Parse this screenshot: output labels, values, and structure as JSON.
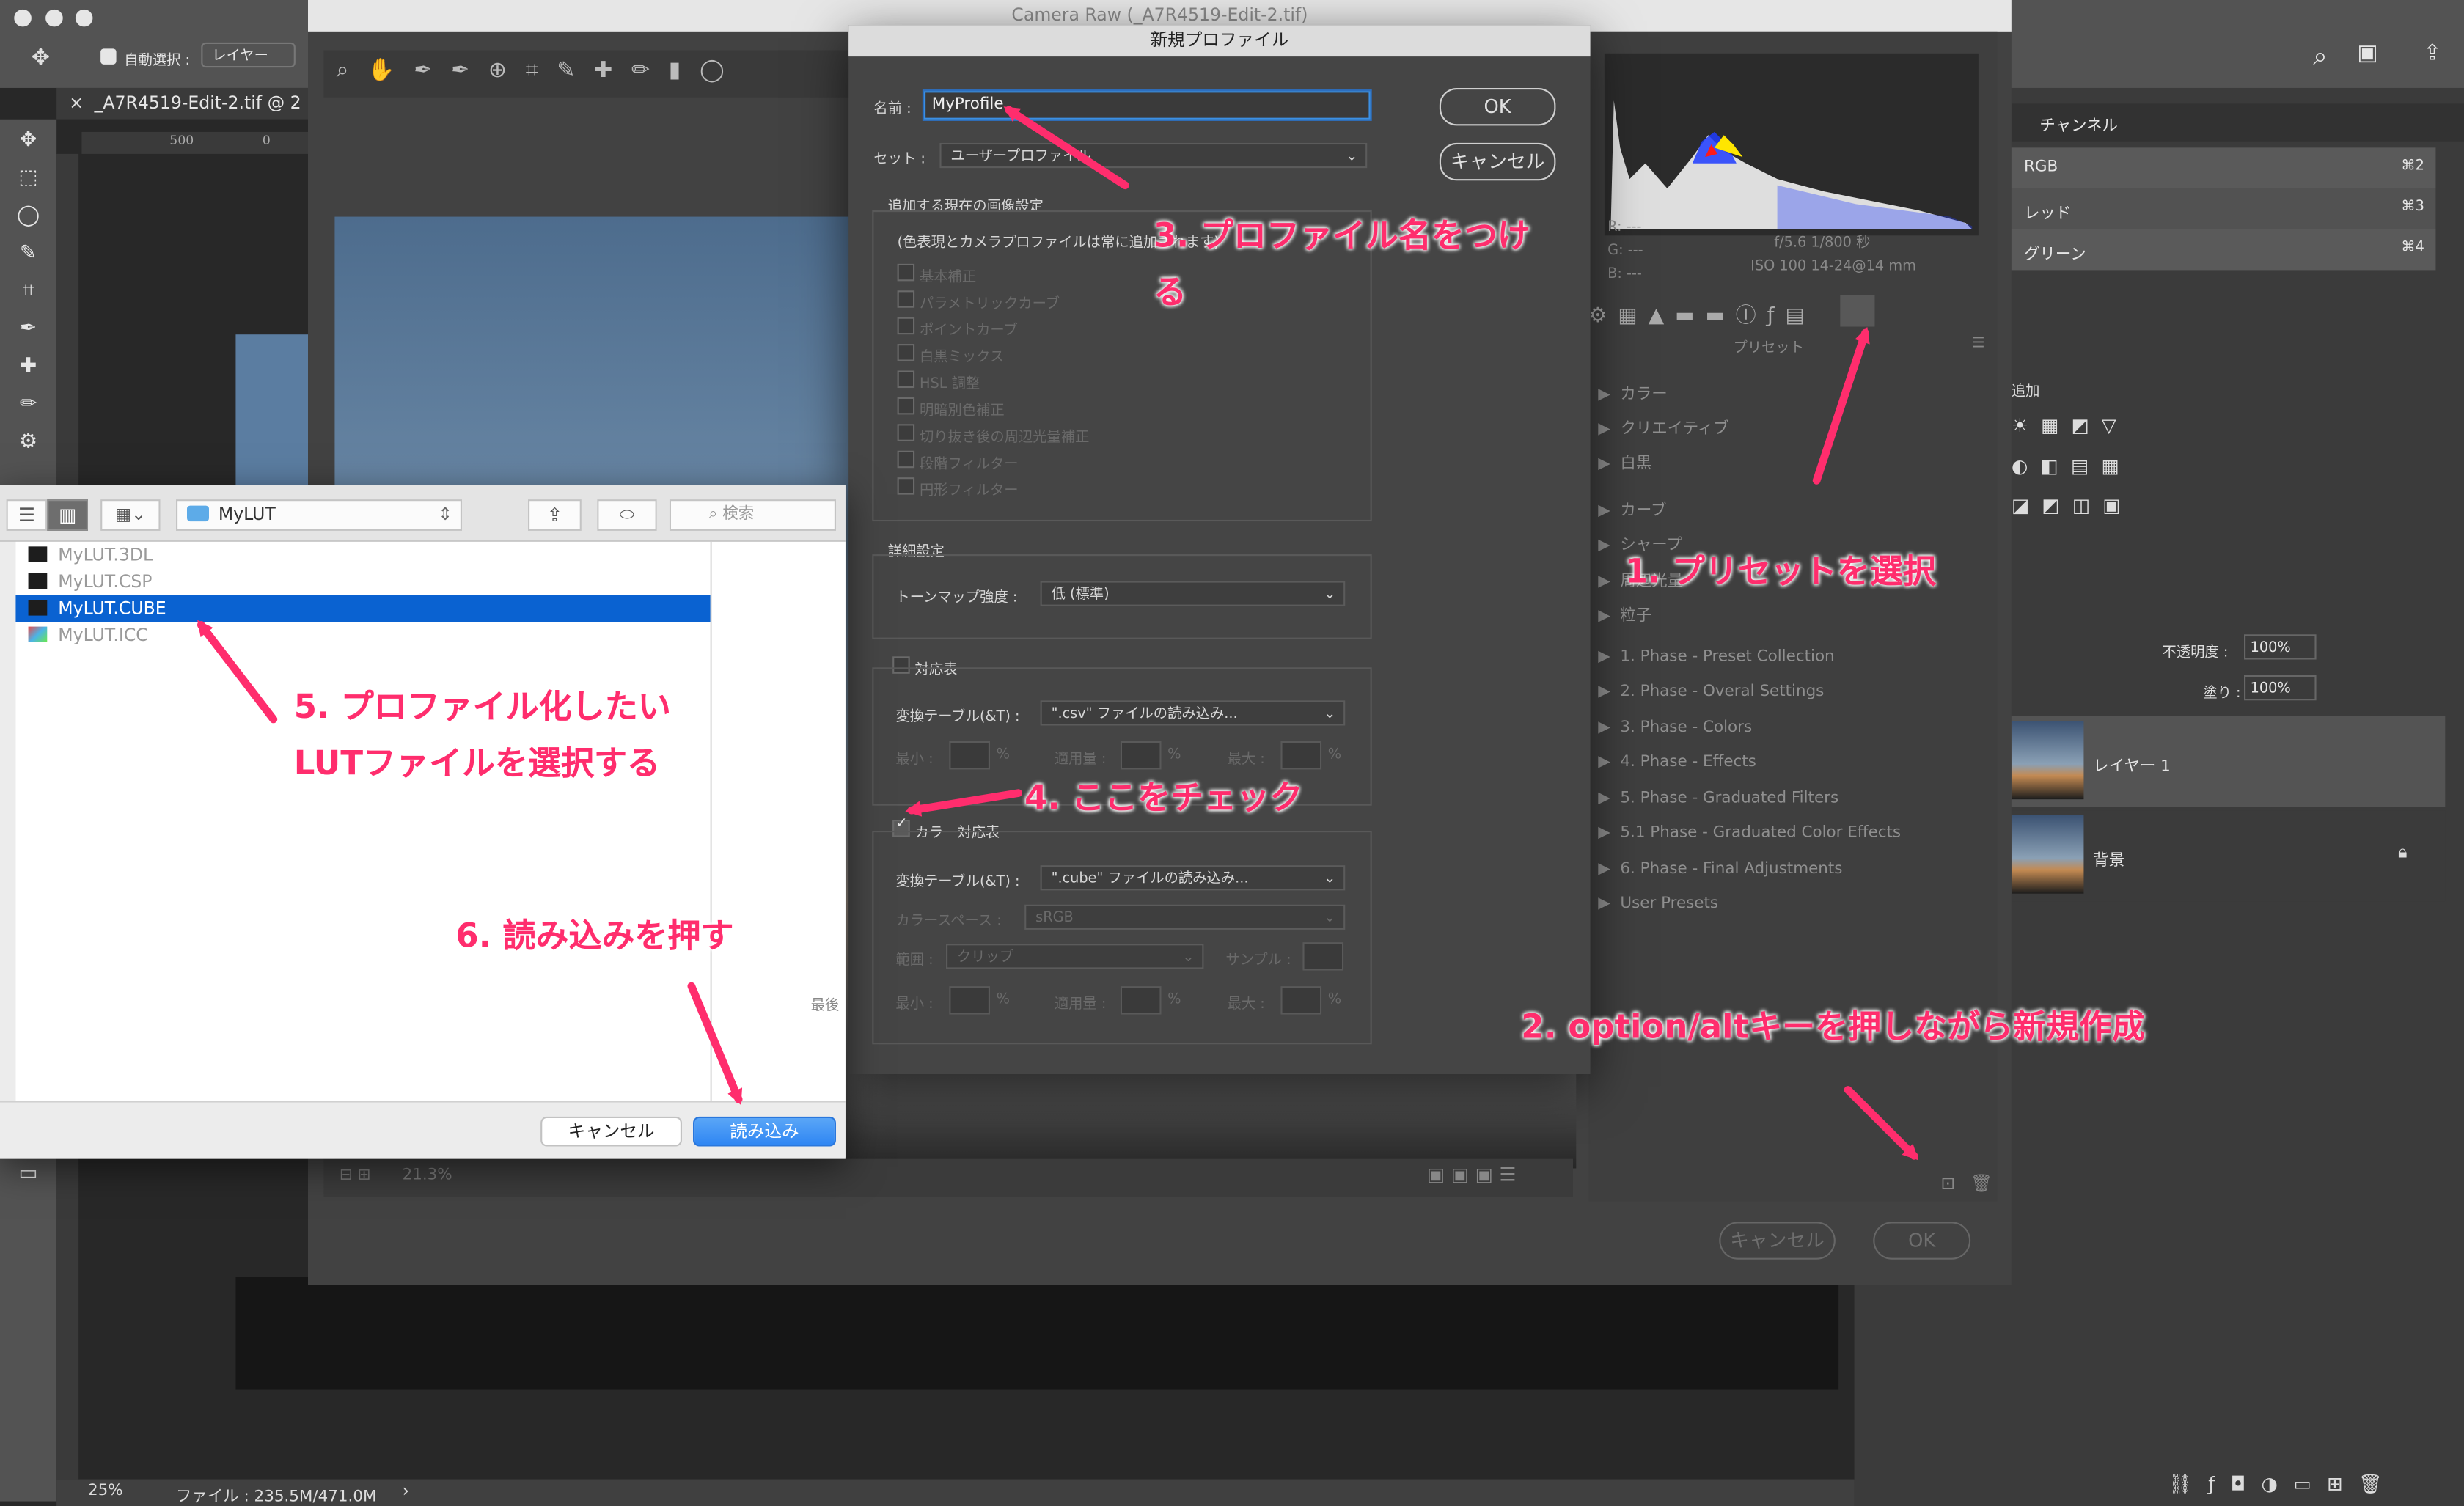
{
  "photoshop": {
    "options": {
      "auto_select": "自動選択 :",
      "layer_select": "レイヤー"
    },
    "doc_tab": "_A7R4519-Edit-2.tif @ 2",
    "ruler_marks": [
      "500",
      "0"
    ],
    "status": {
      "zoom": "25%",
      "file": "ファイル : 235.5M/471.0M"
    },
    "channels": {
      "tab": "チャンネル",
      "rows": [
        {
          "name": "RGB",
          "key": "⌘2"
        },
        {
          "name": "レッド",
          "key": "⌘3"
        },
        {
          "name": "グリーン",
          "key": "⌘4"
        }
      ]
    },
    "adjust_label": "追加",
    "layers": {
      "opacity_label": "不透明度 :",
      "opacity": "100%",
      "fill_label": "塗り :",
      "fill": "100%",
      "items": [
        {
          "name": "レイヤー 1"
        },
        {
          "name": "背景"
        }
      ]
    }
  },
  "camera_raw": {
    "title": "Camera Raw (_A7R4519-Edit-2.tif)",
    "readout": {
      "r": "R:  ---",
      "g": "G:  ---",
      "b": "B:  ---",
      "aperture": "f/5.6   1/800 秒",
      "iso": "ISO 100   14-24@14 mm"
    },
    "panel_title": "プリセット",
    "groups": [
      "カラー",
      "クリエイティブ",
      "白黒",
      "カーブ",
      "シャープ",
      "周辺光量",
      "粒子"
    ],
    "presets": [
      "1. Phase - Preset Collection",
      "2. Phase - Overal Settings",
      "3. Phase - Colors",
      "4. Phase - Effects",
      "5. Phase - Graduated Filters",
      "5.1 Phase - Graduated Color Effects",
      "6. Phase - Final Adjustments",
      "User Presets"
    ],
    "zoom": "21.3%",
    "cancel": "キャンセル",
    "ok": "OK"
  },
  "new_profile": {
    "title": "新規プロファイル",
    "name_label": "名前 :",
    "name_value": "MyProfile",
    "set_label": "セット :",
    "set_value": "ユーザープロファイル",
    "ok": "OK",
    "cancel": "キャンセル",
    "current_settings": {
      "title": "追加する現在の画像設定",
      "note": "(色表現とカメラプロファイルは常に追加されます)",
      "items": [
        "基本補正",
        "パラメトリックカーブ",
        "ポイントカーブ",
        "白黒ミックス",
        "HSL 調整",
        "明暗別色補正",
        "切り抜き後の周辺光量補正",
        "段階フィルター",
        "円形フィルター"
      ]
    },
    "advanced": {
      "title": "詳細設定",
      "tone_label": "トーンマップ強度 :",
      "tone_value": "低 (標準)"
    },
    "lookup": {
      "title": "対応表",
      "table_label": "変換テーブル(&T) :",
      "table_value": "\".csv\" ファイルの読み込み...",
      "min_label": "最小 :",
      "apply_label": "適用量 :",
      "max_label": "最大 :",
      "pct": "%"
    },
    "color_lookup": {
      "title": "カラー対応表",
      "table_label": "変換テーブル(&T) :",
      "table_value": "\".cube\" ファイルの読み込み...",
      "space_label": "カラースペース :",
      "space_value": "sRGB",
      "range_label": "範囲 :",
      "range_value": "クリップ",
      "sample_label": "サンプル :",
      "min_label": "最小 :",
      "apply_label": "適用量 :",
      "max_label": "最大 :",
      "pct": "%"
    }
  },
  "file_dialog": {
    "folder": "MyLUT",
    "search_placeholder": "検索",
    "files": [
      "MyLUT.3DL",
      "MyLUT.CSP",
      "MyLUT.CUBE",
      "MyLUT.ICC"
    ],
    "selected_index": 2,
    "side_label": "最後",
    "cancel": "キャンセル",
    "load": "読み込み"
  },
  "annotations": {
    "a1": "1. プリセットを選択",
    "a2": "2. option/altキーを押しながら新規作成",
    "a3_line1": "3. プロファイル名をつけ",
    "a3_line2": "る",
    "a4": "4. ここをチェック",
    "a5_line1": "5. プロファイル化したい",
    "a5_line2": "LUTファイルを選択する",
    "a6": "6. 読み込みを押す"
  },
  "colors": {
    "accent": "#ff2d6d",
    "selection": "#0a62d1",
    "button_blue": "#2f86f3"
  }
}
